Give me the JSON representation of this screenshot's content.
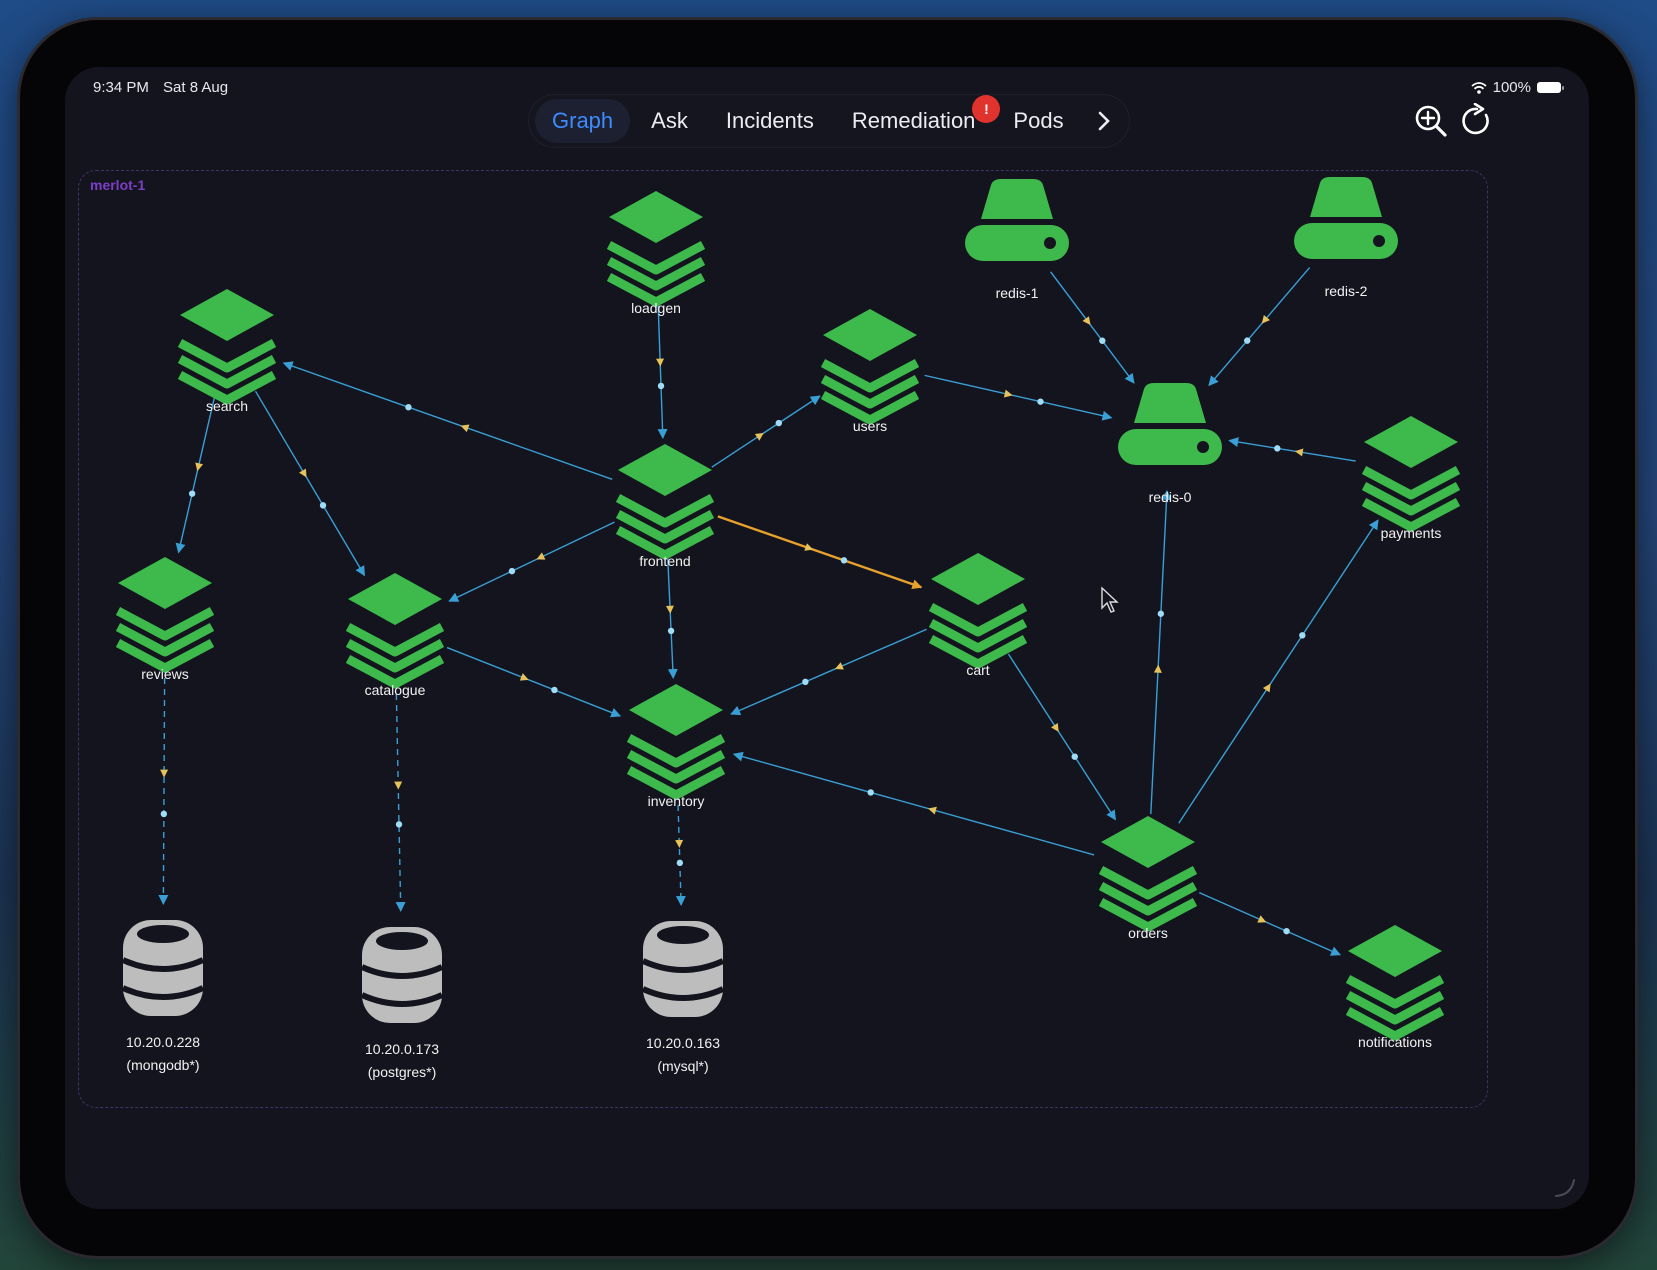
{
  "status_bar": {
    "time": "9:34 PM",
    "date": "Sat 8 Aug",
    "battery": "100%"
  },
  "tabs": [
    {
      "label": "Graph",
      "active": true
    },
    {
      "label": "Ask"
    },
    {
      "label": "Incidents"
    },
    {
      "label": "Remediation",
      "badge": "!"
    },
    {
      "label": "Pods"
    }
  ],
  "toolbar": {
    "zoom_icon": "zoom-in-icon",
    "refresh_icon": "refresh-icon",
    "more_icon": "chevron-right-icon"
  },
  "cluster": {
    "name": "merlot-1"
  },
  "colors": {
    "node": "#3dba4b",
    "storage": "#bdbdbd",
    "edge": "#3a9fd4",
    "edge_highlight": "#e6a22c",
    "arrow_marker": "#e6c25a",
    "accent": "#3d8bfd",
    "badge": "#e0332d"
  },
  "graph": {
    "nodes": [
      {
        "id": "loadgen",
        "label": "loadgen",
        "type": "service"
      },
      {
        "id": "search",
        "label": "search",
        "type": "service"
      },
      {
        "id": "users",
        "label": "users",
        "type": "service"
      },
      {
        "id": "frontend",
        "label": "frontend",
        "type": "service"
      },
      {
        "id": "reviews",
        "label": "reviews",
        "type": "service"
      },
      {
        "id": "catalogue",
        "label": "catalogue",
        "type": "service"
      },
      {
        "id": "cart",
        "label": "cart",
        "type": "service"
      },
      {
        "id": "inventory",
        "label": "inventory",
        "type": "service"
      },
      {
        "id": "orders",
        "label": "orders",
        "type": "service"
      },
      {
        "id": "payments",
        "label": "payments",
        "type": "service"
      },
      {
        "id": "notifications",
        "label": "notifications",
        "type": "service"
      },
      {
        "id": "redis-1",
        "label": "redis-1",
        "type": "cache"
      },
      {
        "id": "redis-2",
        "label": "redis-2",
        "type": "cache"
      },
      {
        "id": "redis-0",
        "label": "redis-0",
        "type": "cache"
      },
      {
        "id": "mongodb",
        "label": "10.20.0.228",
        "sublabel": "(mongodb*)",
        "type": "database"
      },
      {
        "id": "postgres",
        "label": "10.20.0.173",
        "sublabel": "(postgres*)",
        "type": "database"
      },
      {
        "id": "mysql",
        "label": "10.20.0.163",
        "sublabel": "(mysql*)",
        "type": "database"
      }
    ],
    "edges": [
      {
        "from": "loadgen",
        "to": "frontend"
      },
      {
        "from": "frontend",
        "to": "search"
      },
      {
        "from": "frontend",
        "to": "users"
      },
      {
        "from": "frontend",
        "to": "catalogue"
      },
      {
        "from": "frontend",
        "to": "inventory"
      },
      {
        "from": "frontend",
        "to": "cart",
        "highlight": true
      },
      {
        "from": "search",
        "to": "reviews"
      },
      {
        "from": "search",
        "to": "catalogue"
      },
      {
        "from": "users",
        "to": "redis-0"
      },
      {
        "from": "redis-1",
        "to": "redis-0"
      },
      {
        "from": "redis-2",
        "to": "redis-0"
      },
      {
        "from": "payments",
        "to": "redis-0"
      },
      {
        "from": "catalogue",
        "to": "inventory"
      },
      {
        "from": "cart",
        "to": "inventory"
      },
      {
        "from": "cart",
        "to": "orders"
      },
      {
        "from": "orders",
        "to": "inventory"
      },
      {
        "from": "orders",
        "to": "redis-0"
      },
      {
        "from": "orders",
        "to": "payments"
      },
      {
        "from": "orders",
        "to": "notifications"
      },
      {
        "from": "reviews",
        "to": "mongodb",
        "dashed": true
      },
      {
        "from": "catalogue",
        "to": "postgres",
        "dashed": true
      },
      {
        "from": "inventory",
        "to": "mysql",
        "dashed": true
      }
    ]
  }
}
